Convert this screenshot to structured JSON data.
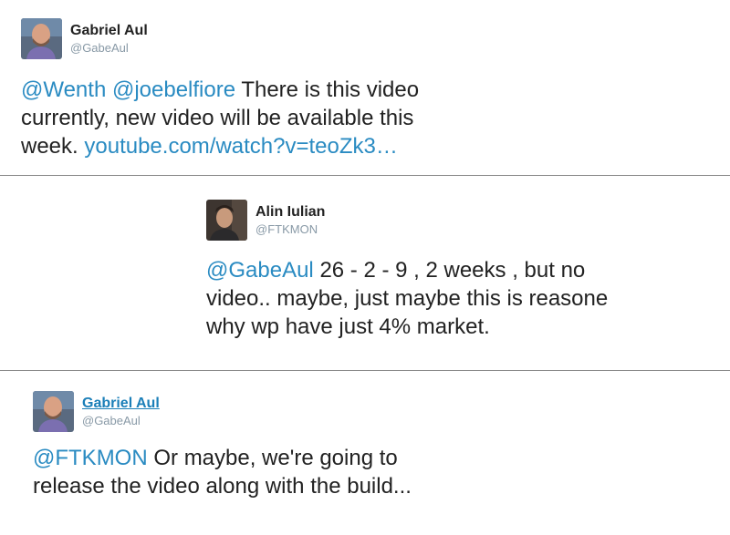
{
  "tweets": [
    {
      "name": "Gabriel Aul",
      "handle": "@GabeAul",
      "mentions": [
        "@Wenth",
        "@joebelfiore"
      ],
      "text_lines": [
        "There is this video",
        "currently, new video will be available this",
        "week."
      ],
      "url": "youtube.com/watch?v=teoZk3…"
    },
    {
      "name": "Alin Iulian",
      "handle": "@FTKMON",
      "mention": "@GabeAul",
      "text_lines": [
        "26 - 2 - 9 , 2 weeks , but no",
        "video.. maybe, just maybe this is reasone",
        "why wp have just 4% market."
      ]
    },
    {
      "name": "Gabriel Aul",
      "handle": "@GabeAul",
      "mention": "@FTKMON",
      "text_lines": [
        "Or maybe, we're going to",
        "release the video along with the build..."
      ]
    }
  ],
  "colors": {
    "link": "#2a8bc2",
    "handle": "#8899a6",
    "text": "#222222"
  }
}
